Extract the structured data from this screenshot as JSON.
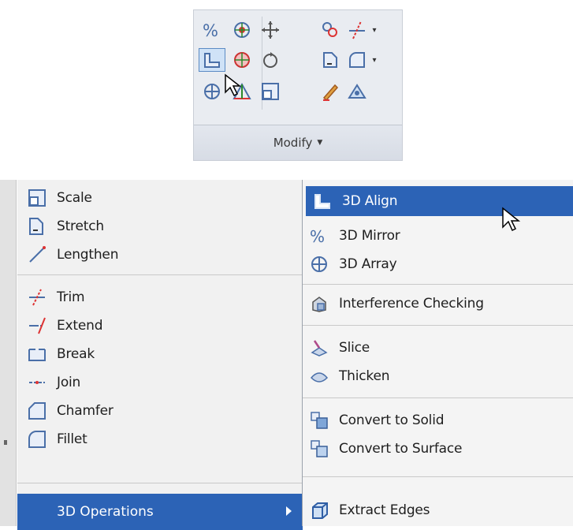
{
  "ribbon": {
    "panel_label": "Modify",
    "tools": [
      {
        "icon": "3d-mirror-icon"
      },
      {
        "icon": "3d-rotate-icon"
      },
      {
        "icon": "move-icon"
      },
      {
        "icon": "copy-icon"
      },
      {
        "icon": "trim-icon"
      },
      {
        "icon": "3d-align-icon"
      },
      {
        "icon": "3d-scale-icon"
      },
      {
        "icon": "rotate-icon"
      },
      {
        "icon": "stretch-icon"
      },
      {
        "icon": "fillet-icon"
      },
      {
        "icon": "3d-array-icon"
      },
      {
        "icon": "align-icon"
      },
      {
        "icon": "scale-icon"
      },
      {
        "icon": "edit-icon"
      },
      {
        "icon": "explode-icon"
      }
    ]
  },
  "menu": {
    "items": [
      {
        "label": "Scale",
        "icon": "scale-icon"
      },
      {
        "label": "Stretch",
        "icon": "stretch-icon"
      },
      {
        "label": "Lengthen",
        "icon": "lengthen-icon"
      },
      {
        "label": "Trim",
        "icon": "trim-icon"
      },
      {
        "label": "Extend",
        "icon": "extend-icon"
      },
      {
        "label": "Break",
        "icon": "break-icon"
      },
      {
        "label": "Join",
        "icon": "join-icon"
      },
      {
        "label": "Chamfer",
        "icon": "chamfer-icon"
      },
      {
        "label": "Fillet",
        "icon": "fillet-icon"
      }
    ],
    "operations": {
      "label": "3D Operations",
      "icon": "submenu-arrow-icon"
    }
  },
  "submenu": {
    "items": [
      {
        "label": "3D Align",
        "icon": "3d-align-icon"
      },
      {
        "label": "3D Mirror",
        "icon": "3d-mirror-icon"
      },
      {
        "label": "3D Array",
        "icon": "3d-array-icon"
      },
      {
        "label": "Interference Checking",
        "icon": "interference-icon"
      },
      {
        "label": "Slice",
        "icon": "slice-icon"
      },
      {
        "label": "Thicken",
        "icon": "thicken-icon"
      },
      {
        "label": "Convert to Solid",
        "icon": "convert-solid-icon"
      },
      {
        "label": "Convert to Surface",
        "icon": "convert-surface-icon"
      },
      {
        "label": "Extract Edges",
        "icon": "extract-edges-icon"
      }
    ]
  },
  "colors": {
    "highlight": "#2c63b6",
    "menu_bg": "#f1f1f1",
    "ribbon_bg": "#e9ecf1"
  }
}
